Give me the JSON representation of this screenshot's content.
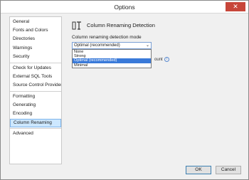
{
  "window": {
    "title": "Options",
    "close_glyph": "✕"
  },
  "sidebar": {
    "groups": [
      [
        "General",
        "Fonts and Colors",
        "Directories",
        "Warnings",
        "Security"
      ],
      [
        "Check for Updates",
        "External SQL Tools",
        "Source Control Providers"
      ],
      [
        "Formatting",
        "Generating",
        "Encoding",
        "Column Renaming"
      ],
      [
        "Advanced"
      ]
    ],
    "selected": "Column Renaming"
  },
  "content": {
    "header_icon": "column-renaming-icon",
    "title": "Column Renaming Detection",
    "field_label": "Column renaming detection mode",
    "select_value": "Optimal (recommended)",
    "options": [
      "None",
      "Strong",
      "Optimal (recommended)",
      "Minimal"
    ],
    "highlighted_option": "Optimal (recommended)",
    "partial_text": "ount"
  },
  "footer": {
    "ok_label": "OK",
    "cancel_label": "Cancel"
  },
  "colors": {
    "accent": "#3a7ad9",
    "selection": "#cde8ff",
    "close": "#c7463a"
  }
}
